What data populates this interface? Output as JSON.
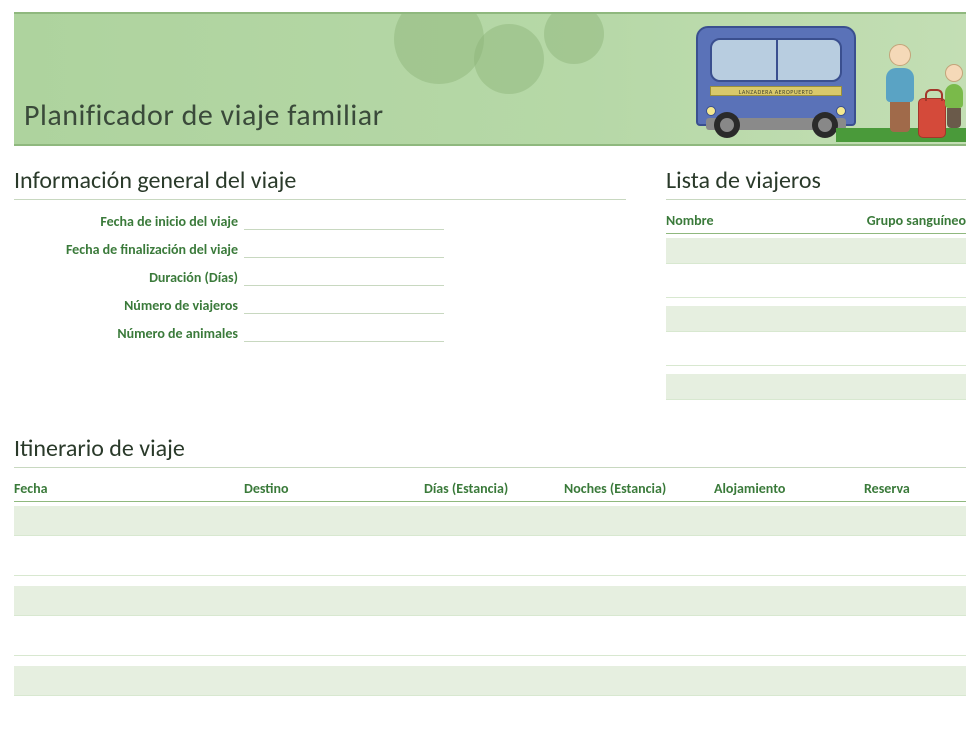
{
  "banner": {
    "title": "Planificador de viaje familiar",
    "bus_sign": "LANZADERA AEROPUERTO"
  },
  "sections": {
    "general": {
      "title": "Información general del viaje",
      "fields": {
        "start_date": "Fecha de inicio del viaje",
        "end_date": "Fecha de finalización del viaje",
        "duration": "Duración (Días)",
        "travelers": "Número de viajeros",
        "animals": "Número de animales"
      }
    },
    "travelers": {
      "title": "Lista de viajeros",
      "columns": {
        "name": "Nombre",
        "blood": "Grupo sanguíneo"
      }
    },
    "itinerary": {
      "title": "Itinerario de viaje",
      "columns": {
        "date": "Fecha",
        "destination": "Destino",
        "days": "Días (Estancia)",
        "nights": "Noches (Estancia)",
        "lodging": "Alojamiento",
        "booking": "Reserva"
      }
    }
  }
}
